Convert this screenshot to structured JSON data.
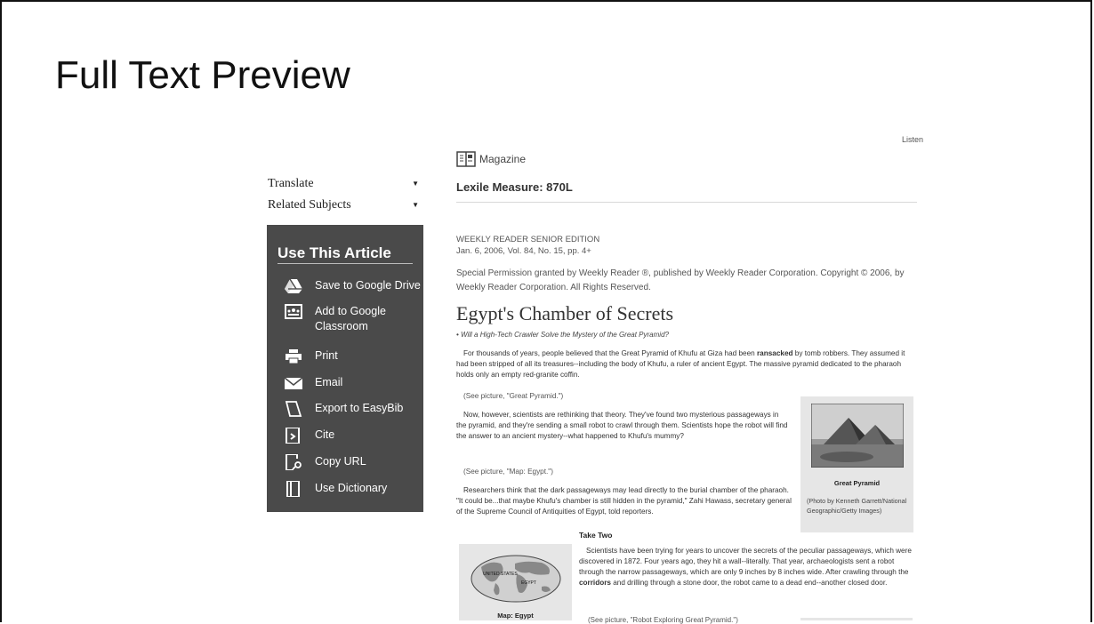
{
  "page": {
    "title": "Full Text Preview"
  },
  "sidebar": {
    "translate_label": "Translate",
    "related_label": "Related Subjects",
    "panel_title": "Use This Article",
    "items": [
      {
        "label": "Save to Google Drive",
        "icon": "google-drive-icon"
      },
      {
        "label": "Add to Google Classroom",
        "icon": "google-classroom-icon"
      },
      {
        "label": "Print",
        "icon": "print-icon"
      },
      {
        "label": "Email",
        "icon": "email-icon"
      },
      {
        "label": "Export to EasyBib",
        "icon": "easybib-icon"
      },
      {
        "label": "Cite",
        "icon": "cite-icon"
      },
      {
        "label": "Copy URL",
        "icon": "copy-url-icon"
      },
      {
        "label": "Use Dictionary",
        "icon": "dictionary-icon"
      }
    ]
  },
  "article": {
    "listen_label": "Listen",
    "type_label": "Magazine",
    "lexile": "Lexile Measure: 870L",
    "source": "WEEKLY READER SENIOR EDITION",
    "issue": "Jan. 6, 2006, Vol. 84, No. 15, pp. 4+",
    "permission": "Special Permission granted by Weekly Reader ®, published by Weekly Reader Corporation. Copyright © 2006, by Weekly Reader Corporation. All Rights Reserved.",
    "headline": "Egypt's Chamber of Secrets",
    "subhead": "• Will a High-Tech Crawler Solve the Mystery of the Great Pyramid?",
    "para1_a": "For thousands of years, people believed that the Great Pyramid of Khufu at Giza had been ",
    "para1_bold": "ransacked",
    "para1_b": " by tomb robbers. They assumed it had been stripped of all its treasures--including the body of Khufu, a ruler of ancient Egypt. The massive pyramid dedicated to the pharaoh holds only an empty red-granite coffin.",
    "see1": "(See picture, \"Great Pyramid.\")",
    "para2": "Now, however, scientists are rethinking that theory. They've found two mysterious passageways in the pyramid, and they're sending a small robot to crawl through them. Scientists hope the robot will find the answer to an ancient mystery--what happened to Khufu's mummy?",
    "see2": "(See picture, \"Map: Egypt.\")",
    "para3": "Researchers think that the dark passageways may lead directly to the burial chamber of the pharaoh. \"It could be...that maybe Khufu's chamber is still hidden in the pyramid,\" Zahi Hawass, secretary general of the Supreme Council of Antiquities of Egypt, told reporters.",
    "fig1_caption": "Great Pyramid",
    "fig1_credit": "(Photo by Kenneth Garrett/National Geographic/Getty Images)",
    "section_heading": "Take Two",
    "para4_a": "Scientists have been trying for years to uncover the secrets of the peculiar passageways, which were discovered in 1872. Four years ago, they hit a wall--literally. That year, archaeologists sent a robot through the narrow passageways, which are only 9 inches by 8 inches wide. After crawling through the ",
    "para4_bold": "corridors",
    "para4_b": " and drilling through a stone door, the robot came to a dead end--another closed door.",
    "fig2_caption": "Map: Egypt",
    "map_label_us": "UNITED STATES",
    "map_label_eg": "EGYPT",
    "see3": "(See picture, \"Robot Exploring Great Pyramid.\")"
  },
  "colors": {
    "panel_bg": "#4a4a4a",
    "figure_bg": "#e6e6e6"
  }
}
